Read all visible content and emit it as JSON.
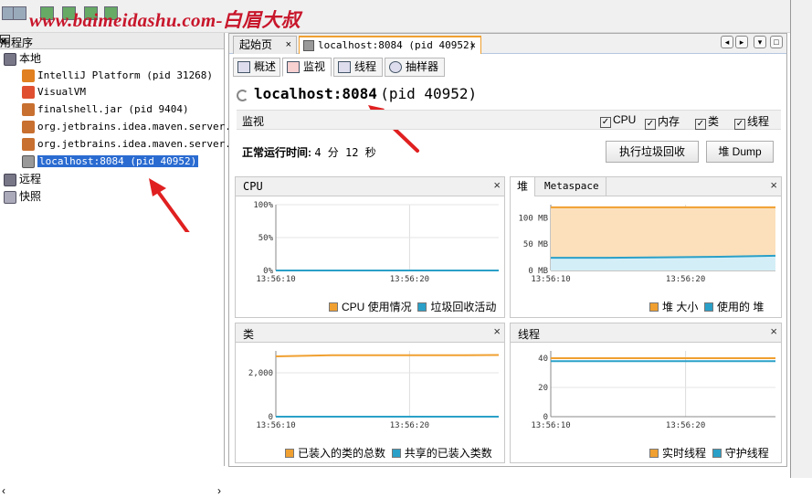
{
  "watermark": "www.baimeidashu.com-白眉大叔",
  "left_panel": {
    "title": "用程序",
    "close": "×",
    "tree": {
      "local": "本地",
      "items": [
        "IntelliJ Platform (pid 31268)",
        "VisualVM",
        "finalshell.jar (pid 9404)",
        "org.jetbrains.idea.maven.server.Re",
        "org.jetbrains.idea.maven.server.Re",
        "localhost:8084 (pid 40952)"
      ],
      "remote": "远程",
      "snapshot": "快照"
    }
  },
  "tabs": [
    {
      "label": "起始页",
      "close": "×"
    },
    {
      "label": "localhost:8084 (pid 40952)",
      "close": "×"
    }
  ],
  "subtabs": [
    "概述",
    "监视",
    "线程",
    "抽样器"
  ],
  "host": {
    "name": "localhost:8084",
    "pid": "(pid 40952)"
  },
  "monitor": {
    "label": "监视",
    "checks": [
      "CPU",
      "内存",
      "类",
      "线程"
    ],
    "uptime_label": "正常运行时间:",
    "uptime_value": "4 分 12 秒",
    "gc_button": "执行垃圾回收",
    "dump_button": "堆 Dump"
  },
  "panels": {
    "cpu": {
      "title": "CPU",
      "close": "×",
      "legend": [
        "CPU 使用情况",
        "垃圾回收活动"
      ]
    },
    "heap": {
      "tab1": "堆",
      "tab2": "Metaspace",
      "close": "×",
      "legend": [
        "堆 大小",
        "使用的 堆"
      ]
    },
    "classes": {
      "title": "类",
      "close": "×",
      "legend": [
        "已装入的类的总数",
        "共享的已装入类数"
      ]
    },
    "threads": {
      "title": "线程",
      "close": "×",
      "legend": [
        "实时线程",
        "守护线程"
      ]
    }
  },
  "colors": {
    "orange": "#f0a030",
    "blue": "#2aa0c8",
    "selection": "#2a6bd1",
    "accent": "#c8162b"
  },
  "chart_data": [
    {
      "type": "line",
      "title": "CPU",
      "x_ticks": [
        "13:56:10",
        "13:56:20"
      ],
      "y_ticks": [
        "0%",
        "50%",
        "100%"
      ],
      "ylim": [
        0,
        100
      ],
      "series": [
        {
          "name": "CPU 使用情况",
          "values": [
            0,
            0,
            0,
            0,
            0
          ]
        },
        {
          "name": "垃圾回收活动",
          "values": [
            0,
            0,
            0,
            0,
            0
          ]
        }
      ]
    },
    {
      "type": "area",
      "title": "堆",
      "x_ticks": [
        "13:56:10",
        "13:56:20"
      ],
      "y_ticks": [
        "0 MB",
        "50 MB",
        "100 MB"
      ],
      "ylim": [
        0,
        125
      ],
      "series": [
        {
          "name": "堆 大小",
          "values": [
            120,
            120,
            120,
            120,
            120
          ]
        },
        {
          "name": "使用的 堆",
          "values": [
            24,
            24,
            25,
            26,
            28
          ]
        }
      ]
    },
    {
      "type": "line",
      "title": "类",
      "x_ticks": [
        "13:56:10",
        "13:56:20"
      ],
      "y_ticks": [
        "0",
        "2,000"
      ],
      "ylim": [
        0,
        3000
      ],
      "series": [
        {
          "name": "已装入的类的总数",
          "values": [
            2750,
            2800,
            2800,
            2800,
            2810
          ]
        },
        {
          "name": "共享的已装入类数",
          "values": [
            0,
            0,
            0,
            0,
            0
          ]
        }
      ]
    },
    {
      "type": "line",
      "title": "线程",
      "x_ticks": [
        "13:56:10",
        "13:56:20"
      ],
      "y_ticks": [
        "0",
        "20",
        "40"
      ],
      "ylim": [
        0,
        45
      ],
      "series": [
        {
          "name": "实时线程",
          "values": [
            40,
            40,
            40,
            40,
            40
          ]
        },
        {
          "name": "守护线程",
          "values": [
            38,
            38,
            38,
            38,
            38
          ]
        }
      ]
    }
  ]
}
